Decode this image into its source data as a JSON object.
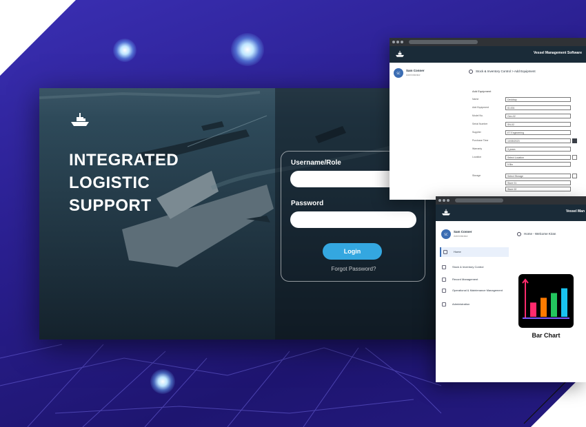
{
  "hero": {
    "headline_lines": [
      "INTEGRATED",
      "LOGISTIC",
      "SUPPORT"
    ]
  },
  "login_form": {
    "username_label": "Username/Role",
    "password_label": "Password",
    "username_value": "",
    "password_value": "",
    "login_button": "Login",
    "forgot_link": "Forgot Password?"
  },
  "equipment_window": {
    "app_title": "Vessel Management Software",
    "user_name": "Sam Conner",
    "user_role": "Administrator",
    "breadcrumb": "Stock & Inventory Control > Add Equipment",
    "section": "Add Equipment",
    "fields": [
      {
        "label": "Name",
        "value": "Deckbay"
      },
      {
        "label": "Add Equipment",
        "value": "ID-001"
      },
      {
        "label": "Model No.",
        "value": "Gen-02"
      },
      {
        "label": "Serial Number",
        "value": "SN-02"
      },
      {
        "label": "Supplier",
        "value": "ET Engineering"
      },
      {
        "label": "Purchase Time",
        "value": "10/05/2023"
      },
      {
        "label": "Warranty",
        "value": "3 years"
      },
      {
        "label": "Location",
        "value": "Select Location"
      },
      {
        "label": "",
        "value": "5 Bin"
      },
      {
        "label": "Storage",
        "value": "Select Storage"
      },
      {
        "label": "",
        "value": "Store 01"
      },
      {
        "label": "",
        "value": "Store 02"
      }
    ]
  },
  "dashboard_window": {
    "app_title": "Vessel Man",
    "user_name": "Sam Conner",
    "user_role": "Administrator",
    "breadcrumb": "Home - Welcome Kiran",
    "nav": [
      {
        "label": "Home",
        "icon": "home-icon",
        "active": true
      },
      {
        "label": "Stock & Inventory Control",
        "icon": "box-icon",
        "active": false
      },
      {
        "label": "Record Management",
        "icon": "document-icon",
        "active": false
      },
      {
        "label": "Operational & Maintenance Management",
        "icon": "wrench-icon",
        "active": false
      },
      {
        "label": "Administration",
        "icon": "users-icon",
        "active": false
      }
    ],
    "tile_caption": "Bar Chart",
    "tile_bars": [
      0.45,
      0.6,
      0.75,
      0.9
    ],
    "tile_colors": [
      "#ff2a6d",
      "#ff7a00",
      "#23c55e",
      "#19c3ef"
    ]
  },
  "colors": {
    "banner": "#2a1f8f",
    "login_button": "#34a7e0"
  }
}
